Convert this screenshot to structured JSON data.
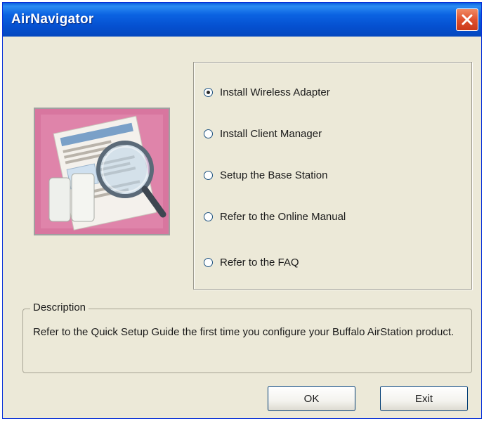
{
  "window": {
    "title": "AirNavigator"
  },
  "options": [
    {
      "label": "Install Wireless Adapter",
      "selected": true
    },
    {
      "label": "Install Client Manager",
      "selected": false
    },
    {
      "label": "Setup the Base Station",
      "selected": false
    },
    {
      "label": "Refer to the Online Manual",
      "selected": false
    },
    {
      "label": "Refer to the FAQ",
      "selected": false
    }
  ],
  "description": {
    "legend": "Description",
    "text": "Refer to the Quick Setup Guide the first time you configure your Buffalo AirStation product."
  },
  "buttons": {
    "ok": "OK",
    "exit": "Exit"
  },
  "icons": {
    "close": "close-icon",
    "illustration": "setup-guide-magnifier-image"
  },
  "colors": {
    "titlebar": "#0550d0",
    "close": "#e0512e",
    "dialog": "#ece9d8",
    "illustration_bg": "#d4709a"
  }
}
